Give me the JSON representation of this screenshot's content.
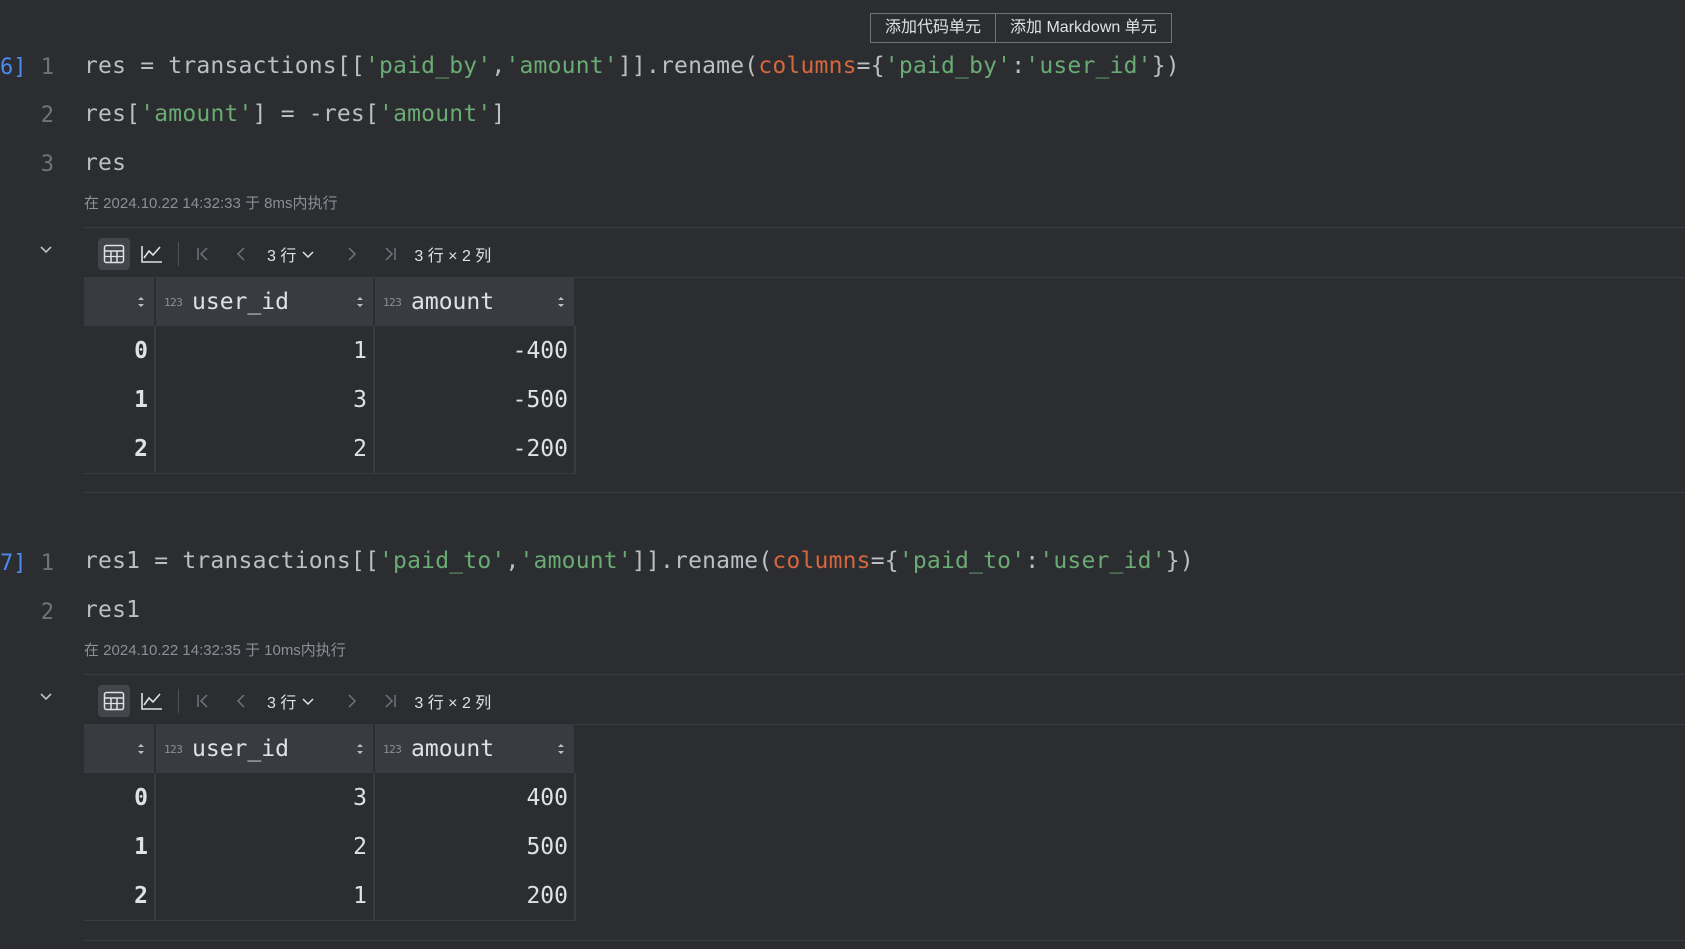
{
  "toolbar": {
    "add_code": "添加代码单元",
    "add_markdown": "添加 Markdown 单元"
  },
  "cells": [
    {
      "exec_count": "6]",
      "line_numbers": [
        "1",
        "2",
        "3"
      ],
      "exec_info": "在 2024.10.22 14:32:33 于 8ms内执行",
      "output": {
        "rows_label": "3 行",
        "shape_label": "3 行 × 2 列",
        "columns": [
          "user_id",
          "amount"
        ],
        "type_label": "123",
        "rows": [
          {
            "index": "0",
            "user_id": "1",
            "amount": "-400"
          },
          {
            "index": "1",
            "user_id": "3",
            "amount": "-500"
          },
          {
            "index": "2",
            "user_id": "2",
            "amount": "-200"
          }
        ]
      }
    },
    {
      "exec_count": "7]",
      "line_numbers": [
        "1",
        "2"
      ],
      "exec_info": "在 2024.10.22 14:32:35 于 10ms内执行",
      "output": {
        "rows_label": "3 行",
        "shape_label": "3 行 × 2 列",
        "columns": [
          "user_id",
          "amount"
        ],
        "type_label": "123",
        "rows": [
          {
            "index": "0",
            "user_id": "3",
            "amount": "400"
          },
          {
            "index": "1",
            "user_id": "2",
            "amount": "500"
          },
          {
            "index": "2",
            "user_id": "1",
            "amount": "200"
          }
        ]
      }
    }
  ],
  "code": {
    "c1": {
      "l1": {
        "a": "res = transactions[[",
        "s1": "'paid_by'",
        "b": ",",
        "s2": "'amount'",
        "c": "]].rename(",
        "kw": "columns",
        "d": "={",
        "s3": "'paid_by'",
        "e": ":",
        "s4": "'user_id'",
        "f": "})"
      },
      "l2": {
        "a": "res[",
        "s1": "'amount'",
        "b": "] = -res[",
        "s2": "'amount'",
        "c": "]"
      },
      "l3": {
        "a": "res"
      }
    },
    "c2": {
      "l1": {
        "a": "res1 = transactions[[",
        "s1": "'paid_to'",
        "b": ",",
        "s2": "'amount'",
        "c": "]].rename(",
        "kw": "columns",
        "d": "={",
        "s3": "'paid_to'",
        "e": ":",
        "s4": "'user_id'",
        "f": "})"
      },
      "l2": {
        "a": "res1"
      }
    }
  },
  "icons": [
    "table-icon",
    "chart-icon",
    "first-page-icon",
    "prev-page-icon",
    "chevron-down-icon",
    "next-page-icon",
    "last-page-icon",
    "sort-icon",
    "collapse-chevron-icon"
  ]
}
